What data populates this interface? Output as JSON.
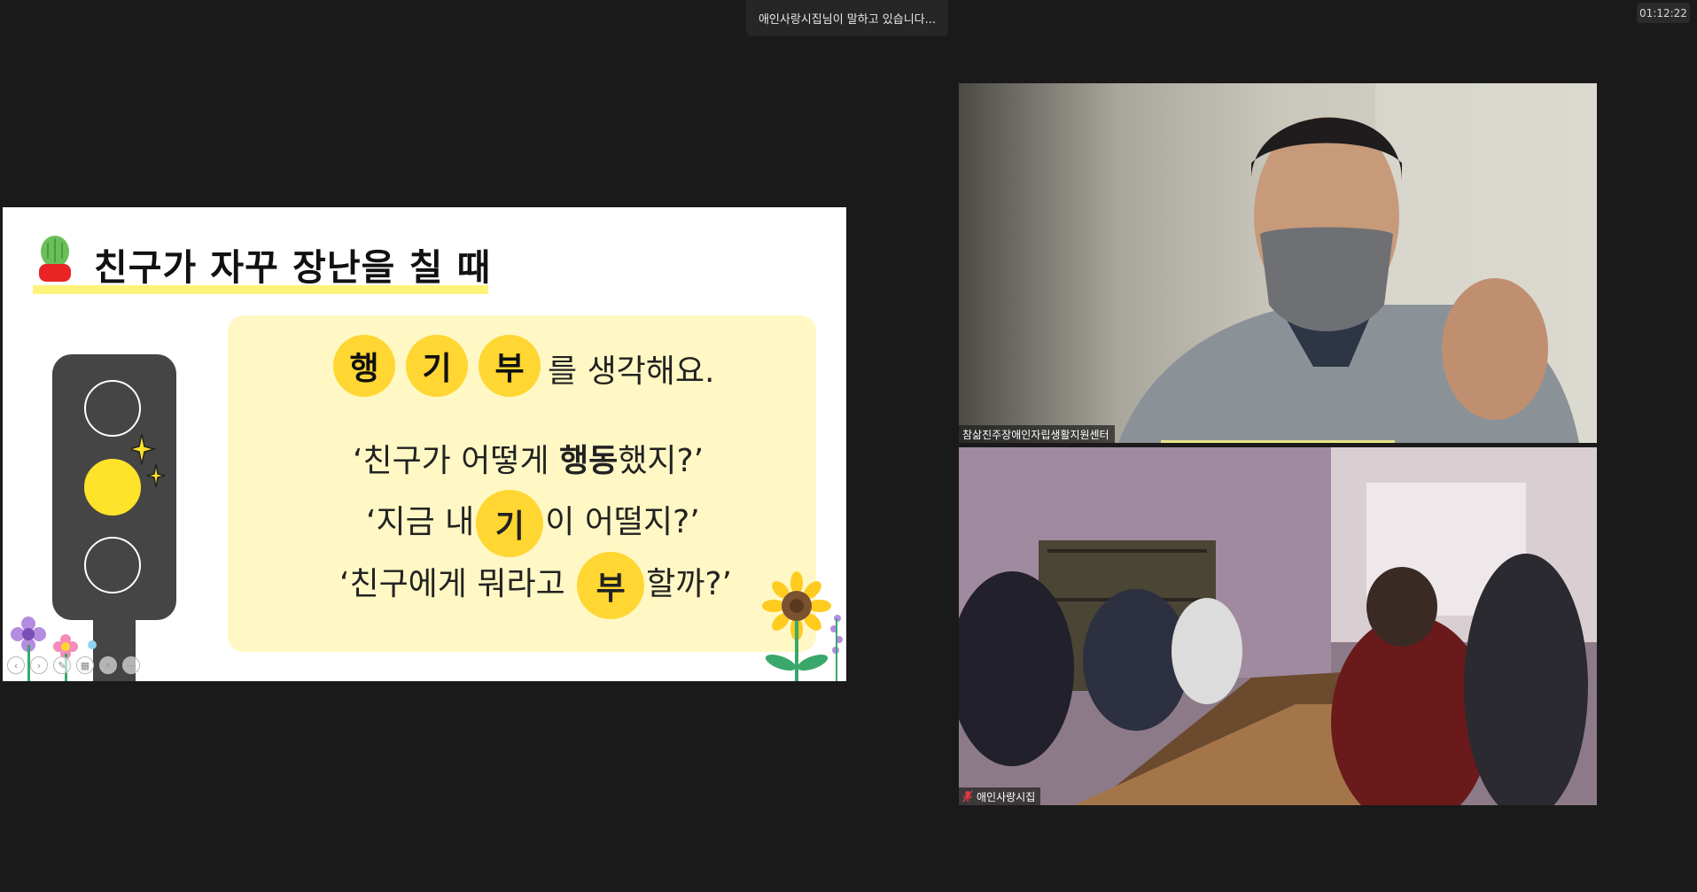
{
  "meeting": {
    "speaking_banner": "애인사랑시집님이 말하고 있습니다...",
    "timer": "01:12:22"
  },
  "slide": {
    "title": "친구가 자꾸 장난을 칠 때",
    "keywords": [
      "행",
      "기",
      "부"
    ],
    "keywords_suffix": "를 생각해요.",
    "line1_a": "‘친구가 어떻게 ",
    "line1_bold": "행동",
    "line1_b": "했지?’",
    "line2_a": "‘지금 내",
    "line2_circle": "기",
    "line2_b": "이 어떨지?’",
    "line3_a": "‘친구에게 뭐라고 ",
    "line3_circle": "부",
    "line3_b": "할까?’"
  },
  "participants": [
    {
      "name": "참삶진주장애인자립생활지원센터",
      "speaking": true
    },
    {
      "name": "애인사랑시집",
      "muted": true
    }
  ],
  "colors": {
    "background": "#1a1a1a",
    "accent_yellow": "#ffd632",
    "card_yellow": "#fff8c4",
    "active_speaker": "#e8e48a"
  }
}
